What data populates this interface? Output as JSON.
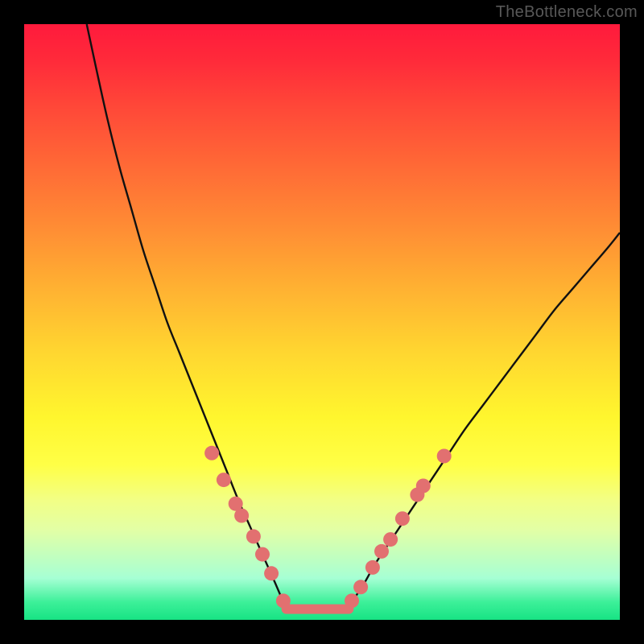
{
  "watermark": "TheBottleneck.com",
  "chart_data": {
    "type": "line",
    "title": "",
    "xlabel": "",
    "ylabel": "",
    "xlim": [
      0,
      100
    ],
    "ylim": [
      0,
      100
    ],
    "grid": false,
    "legend": false,
    "series": [
      {
        "name": "left-curve",
        "stroke": "#111111",
        "stroke_width": 2.4,
        "x": [
          10.5,
          12,
          14,
          16,
          18,
          20,
          22,
          24,
          26,
          28,
          30,
          32,
          34,
          36,
          38,
          40,
          42,
          43.5
        ],
        "y": [
          100,
          93,
          84,
          76,
          69,
          62,
          56,
          50,
          45,
          40,
          35,
          30,
          25,
          20,
          15.5,
          11,
          6.5,
          3
        ]
      },
      {
        "name": "right-curve",
        "stroke": "#111111",
        "stroke_width": 2.4,
        "x": [
          55,
          57,
          59,
          62,
          65,
          68,
          71,
          74,
          77,
          80,
          83,
          86,
          89,
          92,
          95,
          98,
          100
        ],
        "y": [
          3,
          6,
          9.5,
          14,
          18.5,
          23,
          27.5,
          32,
          36,
          40,
          44,
          48,
          52,
          55.5,
          59,
          62.5,
          65
        ]
      },
      {
        "name": "valley-floor",
        "stroke": "#e27070",
        "stroke_width": 12,
        "linecap": "round",
        "x": [
          44,
          54.5
        ],
        "y": [
          1.8,
          1.8
        ]
      }
    ],
    "markers": [
      {
        "group": "left-dots",
        "fill": "#e27070",
        "r": 9,
        "points": [
          {
            "x": 31.5,
            "y": 28
          },
          {
            "x": 33.5,
            "y": 23.5
          },
          {
            "x": 35.5,
            "y": 19.5
          },
          {
            "x": 36.5,
            "y": 17.5
          },
          {
            "x": 38.5,
            "y": 14
          },
          {
            "x": 40.0,
            "y": 11
          },
          {
            "x": 41.5,
            "y": 7.8
          },
          {
            "x": 43.5,
            "y": 3.2
          }
        ]
      },
      {
        "group": "right-dots",
        "fill": "#e27070",
        "r": 9,
        "points": [
          {
            "x": 55.0,
            "y": 3.2
          },
          {
            "x": 56.5,
            "y": 5.5
          },
          {
            "x": 58.5,
            "y": 8.8
          },
          {
            "x": 60.0,
            "y": 11.5
          },
          {
            "x": 61.5,
            "y": 13.5
          },
          {
            "x": 63.5,
            "y": 17
          },
          {
            "x": 66.0,
            "y": 21
          },
          {
            "x": 67.0,
            "y": 22.5
          },
          {
            "x": 70.5,
            "y": 27.5
          }
        ]
      }
    ]
  }
}
